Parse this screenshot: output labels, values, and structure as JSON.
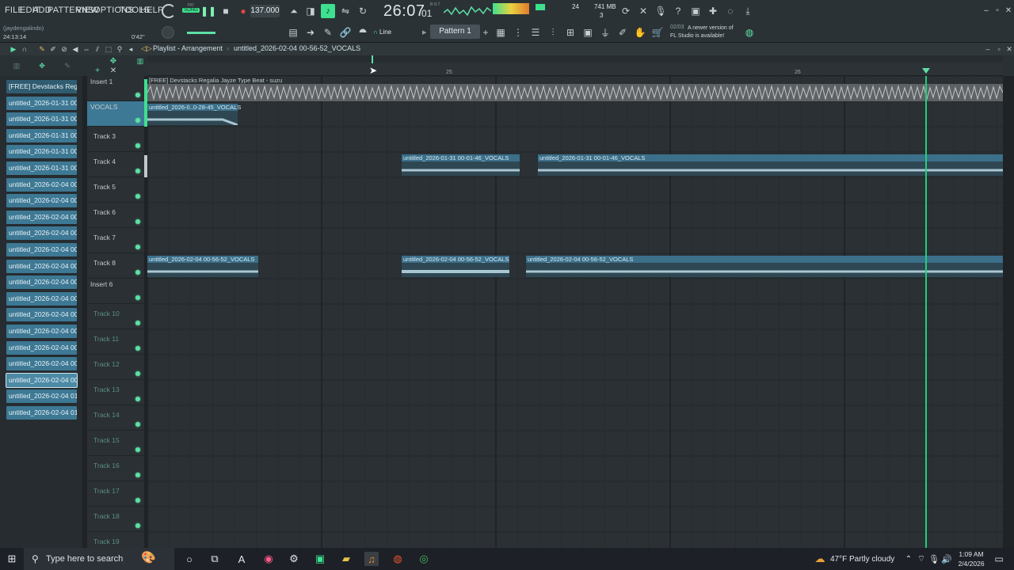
{
  "menu": [
    "FILE",
    "EDIT",
    "ADD",
    "PATTERNS",
    "VIEW",
    "OPTIONS",
    "TOOLS",
    "HELP"
  ],
  "transport": {
    "mode_top": "PAT",
    "mode": "SONG",
    "tempo": "137.000",
    "time": "26:07",
    "time_sub": "01",
    "time_unit": "B:S:T"
  },
  "meters": {
    "cpu": "24",
    "mem": "741 MB",
    "voices": "3"
  },
  "user": {
    "name": "(jaydengalindo)",
    "clock": "24:13:14",
    "stamp": "0'42\""
  },
  "toolbar2": {
    "snap": "Line",
    "pattern": "Pattern 1"
  },
  "news": {
    "date": "02/03",
    "text": "A newer version of FL Studio is available!"
  },
  "playlist": {
    "title": "Playlist - Arrangement",
    "crumb": "untitled_2026-02-04 00-56-52_VOCALS"
  },
  "ruler": {
    "mark_a": "25",
    "mark_b": "26"
  },
  "browser_items": [
    "[FREE] Devstacks  Regalia",
    "untitled_2026-01-31 00-...",
    "untitled_2026-01-31 00-...",
    "untitled_2026-01-31 00-...",
    "untitled_2026-01-31 00-...",
    "untitled_2026-01-31 00-...",
    "untitled_2026-02-04 00-...",
    "untitled_2026-02-04 00-...",
    "untitled_2026-02-04 00-...",
    "untitled_2026-02-04 00-...",
    "untitled_2026-02-04 00-...",
    "untitled_2026-02-04 00-...",
    "untitled_2026-02-04 00-...",
    "untitled_2026-02-04 00-...",
    "untitled_2026-02-04 00-...",
    "untitled_2026-02-04 00-...",
    "untitled_2026-02-04 00-...",
    "untitled_2026-02-04 00-...",
    "untitled_2026-02-04 00-...",
    "untitled_2026-02-04 01-...",
    "untitled_2026-02-04 01-..."
  ],
  "tracks": [
    "Insert 1",
    "VOCALS",
    "Track 3",
    "Track 4",
    "Track 5",
    "Track 6",
    "Track 7",
    "Track 8",
    "Insert 6",
    "Track 10",
    "Track 11",
    "Track 12",
    "Track 13",
    "Track 14",
    "Track 15",
    "Track 16",
    "Track 17",
    "Track 18",
    "Track 19"
  ],
  "clips": {
    "beat": "[FREE] Devstacks  Regalia  Jayze Type Beat - suzu",
    "vocal_short": "untitled_2026-0..0-28-45_VOCALS",
    "t4a": "untitled_2026-01-31 00-01-46_VOCALS",
    "t4b": "untitled_2026-01-31 00-01-46_VOCALS",
    "t8a": "untitled_2026-02-04 00-56-52_VOCALS",
    "t8b": "untitled_2026-02-04 00-56-52_VOCALS",
    "t8c": "untitled_2026-02-04 00-56-52_VOCALS"
  },
  "taskbar": {
    "search": "Type here to search",
    "weather": "47°F  Partly cloudy",
    "time": "1:09 AM",
    "date": "2/4/2026"
  },
  "colors": {
    "accent": "#5de0a5",
    "clip": "#3b6f8a",
    "playhead": "#1fd07a"
  }
}
